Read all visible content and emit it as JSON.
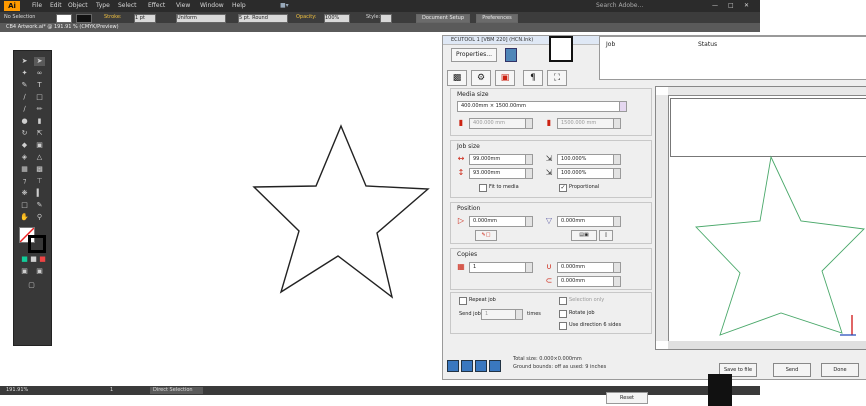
{
  "ai": {
    "logo": "Ai",
    "menus": [
      "File",
      "Edit",
      "Object",
      "Type",
      "Select",
      "Effect",
      "View",
      "Window",
      "Help"
    ],
    "search_placeholder": "Search Adobe...",
    "control": {
      "selection_label": "No Selection",
      "stroke_label": "Stroke:",
      "stroke_weight": "1 pt",
      "uniform_label": "Uniform",
      "brush_label": "5 pt. Round",
      "opacity_label": "Opacity:",
      "opacity_value": "100%",
      "style_label": "Style:",
      "doc_setup": "Document Setup",
      "preferences": "Preferences"
    },
    "doc_tab": "CB4 Artwork.ai* @ 191.91 % (CMYK/Preview)",
    "status": {
      "zoom": "191.91%",
      "artboard": "1",
      "tool": "Direct Selection"
    }
  },
  "plugin": {
    "title": "ECUTOOL 1 [VBM 220] (HCN.Ink)",
    "properties_button": "Properties...",
    "job_table": {
      "columns": [
        "Job",
        "Status"
      ]
    },
    "media": {
      "title": "Media size",
      "size_value": "400.00mm × 1500.00mm",
      "width_value": "400.000 mm",
      "height_value": "1500.000 mm"
    },
    "job_size": {
      "title": "Job size",
      "width": "99.000mm",
      "height": "93.000mm",
      "scale_x": "100.000%",
      "scale_y": "100.000%",
      "fit_media": "Fit to media",
      "proportional": "Proportional"
    },
    "position": {
      "title": "Position",
      "x": "0.000mm",
      "y": "0.000mm"
    },
    "copies": {
      "title": "Copies",
      "count": "1",
      "spacing_x": "0.000mm",
      "spacing_y": "0.000mm"
    },
    "repeat": {
      "repeat_job": "Repeat job",
      "send_job": "Send job",
      "send_value": "1",
      "times": "times",
      "selection_only": "Selection only",
      "rotate_job": "Rotate job",
      "use_direction": "Use direction 6 sides"
    },
    "reset_button": "Reset",
    "footer": {
      "total_line1": "Total size: 0.000×0.000mm",
      "total_line2": "Ground bounds: off as used: 9 inches",
      "buttons": [
        "Save to file",
        "Send",
        "Done"
      ]
    }
  }
}
